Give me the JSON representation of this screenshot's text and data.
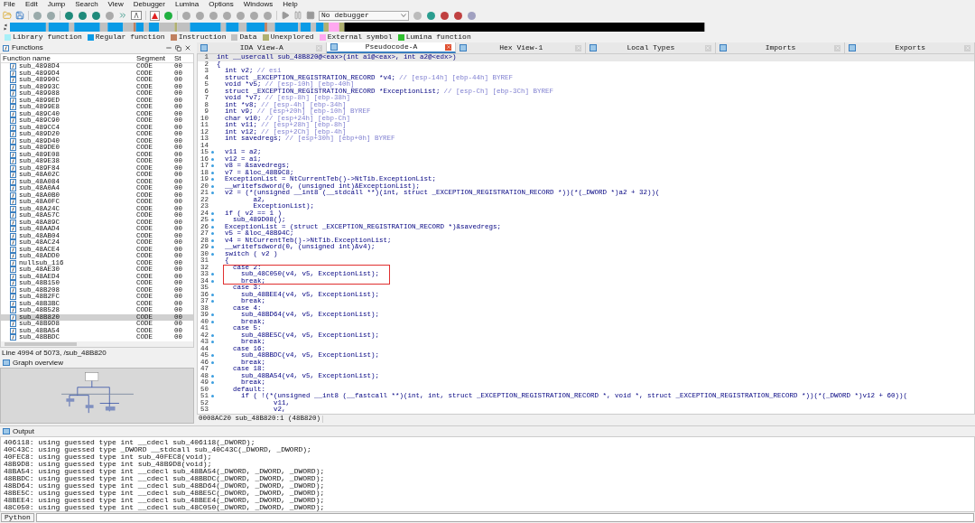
{
  "menu": [
    "File",
    "Edit",
    "Jump",
    "Search",
    "View",
    "Debugger",
    "Lumina",
    "Options",
    "Windows",
    "Help"
  ],
  "toolbar": {
    "debugger_select": "No debugger"
  },
  "legend": [
    {
      "label": "Library function",
      "color": "#a8f0f8"
    },
    {
      "label": "Regular function",
      "color": "#0a9be6"
    },
    {
      "label": "Instruction",
      "color": "#c08060"
    },
    {
      "label": "Data",
      "color": "#c0c0c0"
    },
    {
      "label": "Unexplored",
      "color": "#b0b070"
    },
    {
      "label": "External symbol",
      "color": "#ffa8f0"
    },
    {
      "label": "Lumina function",
      "color": "#30c030"
    }
  ],
  "functions": {
    "title": "Functions",
    "columns": [
      "Function name",
      "Segment",
      "St"
    ],
    "rows": [
      {
        "name": "sub_4898D4",
        "segment": "CODE",
        "st": "00",
        "selected": false
      },
      {
        "name": "sub_4899D4",
        "segment": "CODE",
        "st": "00",
        "selected": false
      },
      {
        "name": "sub_48990C",
        "segment": "CODE",
        "st": "00",
        "selected": false
      },
      {
        "name": "sub_48993C",
        "segment": "CODE",
        "st": "00",
        "selected": false
      },
      {
        "name": "sub_489988",
        "segment": "CODE",
        "st": "00",
        "selected": false
      },
      {
        "name": "sub_4899ED",
        "segment": "CODE",
        "st": "00",
        "selected": false
      },
      {
        "name": "sub_4899E8",
        "segment": "CODE",
        "st": "00",
        "selected": false
      },
      {
        "name": "sub_489C40",
        "segment": "CODE",
        "st": "00",
        "selected": false
      },
      {
        "name": "sub_489C90",
        "segment": "CODE",
        "st": "00",
        "selected": false
      },
      {
        "name": "sub_489CC4",
        "segment": "CODE",
        "st": "00",
        "selected": false
      },
      {
        "name": "sub_489D20",
        "segment": "CODE",
        "st": "00",
        "selected": false
      },
      {
        "name": "sub_489D40",
        "segment": "CODE",
        "st": "00",
        "selected": false
      },
      {
        "name": "sub_489DE0",
        "segment": "CODE",
        "st": "00",
        "selected": false
      },
      {
        "name": "sub_489E08",
        "segment": "CODE",
        "st": "00",
        "selected": false
      },
      {
        "name": "sub_489E38",
        "segment": "CODE",
        "st": "00",
        "selected": false
      },
      {
        "name": "sub_489F84",
        "segment": "CODE",
        "st": "00",
        "selected": false
      },
      {
        "name": "sub_48A02C",
        "segment": "CODE",
        "st": "00",
        "selected": false
      },
      {
        "name": "sub_48A084",
        "segment": "CODE",
        "st": "00",
        "selected": false
      },
      {
        "name": "sub_48A0A4",
        "segment": "CODE",
        "st": "00",
        "selected": false
      },
      {
        "name": "sub_48A0B0",
        "segment": "CODE",
        "st": "00",
        "selected": false
      },
      {
        "name": "sub_48A0FC",
        "segment": "CODE",
        "st": "00",
        "selected": false
      },
      {
        "name": "sub_48A24C",
        "segment": "CODE",
        "st": "00",
        "selected": false
      },
      {
        "name": "sub_48A57C",
        "segment": "CODE",
        "st": "00",
        "selected": false
      },
      {
        "name": "sub_48A89C",
        "segment": "CODE",
        "st": "00",
        "selected": false
      },
      {
        "name": "sub_48AAD4",
        "segment": "CODE",
        "st": "00",
        "selected": false
      },
      {
        "name": "sub_48AB04",
        "segment": "CODE",
        "st": "00",
        "selected": false
      },
      {
        "name": "sub_48AC24",
        "segment": "CODE",
        "st": "00",
        "selected": false
      },
      {
        "name": "sub_48ACE4",
        "segment": "CODE",
        "st": "00",
        "selected": false
      },
      {
        "name": "sub_48ADD0",
        "segment": "CODE",
        "st": "00",
        "selected": false
      },
      {
        "name": "nullsub_116",
        "segment": "CODE",
        "st": "00",
        "selected": false
      },
      {
        "name": "sub_48AE30",
        "segment": "CODE",
        "st": "00",
        "selected": false
      },
      {
        "name": "sub_48AED4",
        "segment": "CODE",
        "st": "00",
        "selected": false
      },
      {
        "name": "sub_48B150",
        "segment": "CODE",
        "st": "00",
        "selected": false
      },
      {
        "name": "sub_48B208",
        "segment": "CODE",
        "st": "00",
        "selected": false
      },
      {
        "name": "sub_48B2FC",
        "segment": "CODE",
        "st": "00",
        "selected": false
      },
      {
        "name": "sub_48B3BC",
        "segment": "CODE",
        "st": "00",
        "selected": false
      },
      {
        "name": "sub_48B528",
        "segment": "CODE",
        "st": "00",
        "selected": false
      },
      {
        "name": "sub_48B820",
        "segment": "CODE",
        "st": "00",
        "selected": true
      },
      {
        "name": "sub_48B9D8",
        "segment": "CODE",
        "st": "00",
        "selected": false
      },
      {
        "name": "sub_48BA54",
        "segment": "CODE",
        "st": "00",
        "selected": false
      },
      {
        "name": "sub_48BBDC",
        "segment": "CODE",
        "st": "00",
        "selected": false
      }
    ],
    "status": "Line 4994 of 5073, /sub_48B820"
  },
  "graph_overview": {
    "title": "Graph overview"
  },
  "tabs": [
    {
      "label": "IDA View-A",
      "selected": false
    },
    {
      "label": "Pseudocode-A",
      "selected": true
    },
    {
      "label": "Hex View-1",
      "selected": false
    },
    {
      "label": "Local Types",
      "selected": false
    },
    {
      "label": "Imports",
      "selected": false
    },
    {
      "label": "Exports",
      "selected": false
    }
  ],
  "code": {
    "lines": [
      {
        "number": "1",
        "text": "int __usercall sub_48B820@<eax>(int a1@<eax>, int a2@<edx>)",
        "dot": false,
        "boxed": false
      },
      {
        "number": "2",
        "text": "{",
        "dot": false,
        "boxed": false
      },
      {
        "number": "3",
        "text": "  int v2;",
        "comment": "// esi",
        "dot": false,
        "boxed": false
      },
      {
        "number": "4",
        "text": "  struct _EXCEPTION_REGISTRATION_RECORD *v4;",
        "comment": "// [esp-14h] [ebp-44h] BYREF",
        "dot": false,
        "boxed": false
      },
      {
        "number": "5",
        "text": "  void *v5;",
        "comment": "// [esp-10h] [ebp-40h]",
        "dot": false,
        "boxed": false
      },
      {
        "number": "6",
        "text": "  struct _EXCEPTION_REGISTRATION_RECORD *ExceptionList;",
        "comment": "// [esp-Ch] [ebp-3Ch] BYREF",
        "dot": false,
        "boxed": false
      },
      {
        "number": "7",
        "text": "  void *v7;",
        "comment": "// [esp-8h] [ebp-38h]",
        "dot": false,
        "boxed": false
      },
      {
        "number": "8",
        "text": "  int *v8;",
        "comment": "// [esp-4h] [ebp-34h]",
        "dot": false,
        "boxed": false
      },
      {
        "number": "9",
        "text": "  int v9;",
        "comment": "// [esp+20h] [ebp-10h] BYREF",
        "dot": false,
        "boxed": false
      },
      {
        "number": "10",
        "text": "  char v10;",
        "comment": "// [esp+24h] [ebp-Ch]",
        "dot": false,
        "boxed": false
      },
      {
        "number": "11",
        "text": "  int v11;",
        "comment": "// [esp+28h] [ebp-8h]",
        "dot": false,
        "boxed": false
      },
      {
        "number": "12",
        "text": "  int v12;",
        "comment": "// [esp+2Ch] [ebp-4h]",
        "dot": false,
        "boxed": false
      },
      {
        "number": "13",
        "text": "  int savedregs;",
        "comment": "// [esp+30h] [ebp+0h] BYREF",
        "dot": false,
        "boxed": false
      },
      {
        "number": "14",
        "dot": false,
        "boxed": false
      },
      {
        "number": "15",
        "text": "  v11 = a2;",
        "dot": true,
        "boxed": false
      },
      {
        "number": "16",
        "text": "  v12 = a1;",
        "dot": true,
        "boxed": false
      },
      {
        "number": "17",
        "text": "  v8 = &savedregs;",
        "dot": true,
        "boxed": false
      },
      {
        "number": "18",
        "text": "  v7 = &loc_48B9C8;",
        "dot": true,
        "boxed": false
      },
      {
        "number": "19",
        "text": "  ExceptionList = NtCurrentTeb()->NtTib.ExceptionList;",
        "dot": true,
        "boxed": false
      },
      {
        "number": "20",
        "text": "  __writefsdword(0, (unsigned int)&ExceptionList);",
        "dot": true,
        "boxed": false
      },
      {
        "number": "21",
        "text": "  v2 = (*(unsigned __int8 (__stdcall **)(int, struct _EXCEPTION_REGISTRATION_RECORD *))(*(_DWORD *)a2 + 32))(",
        "dot": true,
        "boxed": false
      },
      {
        "number": "22",
        "text": "         a2,",
        "dot": false,
        "boxed": false
      },
      {
        "number": "23",
        "text": "         ExceptionList);",
        "dot": false,
        "boxed": false
      },
      {
        "number": "24",
        "text": "  if ( v2 == 1 )",
        "dot": true,
        "boxed": false
      },
      {
        "number": "25",
        "text": "    sub_489D08();",
        "dot": true,
        "boxed": false
      },
      {
        "number": "26",
        "text": "  ExceptionList = (struct _EXCEPTION_REGISTRATION_RECORD *)&savedregs;",
        "dot": true,
        "boxed": false
      },
      {
        "number": "27",
        "text": "  v5 = &loc_48B94C;",
        "dot": true,
        "boxed": false
      },
      {
        "number": "28",
        "text": "  v4 = NtCurrentTeb()->NtTib.ExceptionList;",
        "dot": true,
        "boxed": false
      },
      {
        "number": "29",
        "text": "  __writefsdword(0, (unsigned int)&v4);",
        "dot": true,
        "boxed": false
      },
      {
        "number": "30",
        "text": "  switch ( v2 )",
        "dot": true,
        "boxed": false
      },
      {
        "number": "31",
        "text": "  {",
        "dot": false,
        "boxed": false
      },
      {
        "number": "32",
        "text": "    case 2:",
        "dot": false,
        "boxed": true
      },
      {
        "number": "33",
        "text": "      sub_48C050(v4, v5, ExceptionList);",
        "dot": true,
        "boxed": true
      },
      {
        "number": "34",
        "text": "      break;",
        "dot": true,
        "boxed": true
      },
      {
        "number": "35",
        "text": "    case 3:",
        "dot": false,
        "boxed": false
      },
      {
        "number": "36",
        "text": "      sub_48BEE4(v4, v5, ExceptionList);",
        "dot": true,
        "boxed": false
      },
      {
        "number": "37",
        "text": "      break;",
        "dot": true,
        "boxed": false
      },
      {
        "number": "38",
        "text": "    case 4:",
        "dot": false,
        "boxed": false
      },
      {
        "number": "39",
        "text": "      sub_48BD64(v4, v5, ExceptionList);",
        "dot": true,
        "boxed": false
      },
      {
        "number": "40",
        "text": "      break;",
        "dot": true,
        "boxed": false
      },
      {
        "number": "41",
        "text": "    case 5:",
        "dot": false,
        "boxed": false
      },
      {
        "number": "42",
        "text": "      sub_48BE5C(v4, v5, ExceptionList);",
        "dot": true,
        "boxed": false
      },
      {
        "number": "43",
        "text": "      break;",
        "dot": true,
        "boxed": false
      },
      {
        "number": "44",
        "text": "    case 16:",
        "dot": false,
        "boxed": false
      },
      {
        "number": "45",
        "text": "      sub_48BBDC(v4, v5, ExceptionList);",
        "dot": true,
        "boxed": false
      },
      {
        "number": "46",
        "text": "      break;",
        "dot": true,
        "boxed": false
      },
      {
        "number": "47",
        "text": "    case 18:",
        "dot": false,
        "boxed": false
      },
      {
        "number": "48",
        "text": "      sub_48BA54(v4, v5, ExceptionList);",
        "dot": true,
        "boxed": false
      },
      {
        "number": "49",
        "text": "      break;",
        "dot": true,
        "boxed": false
      },
      {
        "number": "50",
        "text": "    default:",
        "dot": false,
        "boxed": false
      },
      {
        "number": "51",
        "text": "      if ( !(*(unsigned __int8 (__fastcall **)(int, int, struct _EXCEPTION_REGISTRATION_RECORD *, void *, struct _EXCEPTION_REGISTRATION_RECORD *))(*(_DWORD *)v12 + 60))(",
        "dot": true,
        "boxed": false
      },
      {
        "number": "52",
        "text": "              v11,",
        "dot": false,
        "boxed": false
      },
      {
        "number": "53",
        "text": "              v2,",
        "dot": false,
        "boxed": false
      }
    ],
    "status": "0008AC20 sub_48B820:1 (48B820)"
  },
  "output": {
    "title": "Output",
    "lines": [
      "406118: using guessed type int __cdecl sub_406118(_DWORD);",
      "40C43C: using guessed type _DWORD __stdcall sub_40C43C(_DWORD, _DWORD);",
      "40FEC8: using guessed type int sub_40FEC8(void);",
      "48B9D8: using guessed type int sub_48B9D8(void);",
      "48BA54: using guessed type int __cdecl sub_48BA54(_DWORD, _DWORD, _DWORD);",
      "48BBDC: using guessed type int __cdecl sub_48BBDC(_DWORD, _DWORD, _DWORD);",
      "48BD64: using guessed type int __cdecl sub_48BD64(_DWORD, _DWORD, _DWORD);",
      "48BE5C: using guessed type int __cdecl sub_48BE5C(_DWORD, _DWORD, _DWORD);",
      "48BEE4: using guessed type int __cdecl sub_48BEE4(_DWORD, _DWORD, _DWORD);",
      "48C050: using guessed type int __cdecl sub_48C050(_DWORD, _DWORD, _DWORD);"
    ],
    "python_button": "Python"
  }
}
